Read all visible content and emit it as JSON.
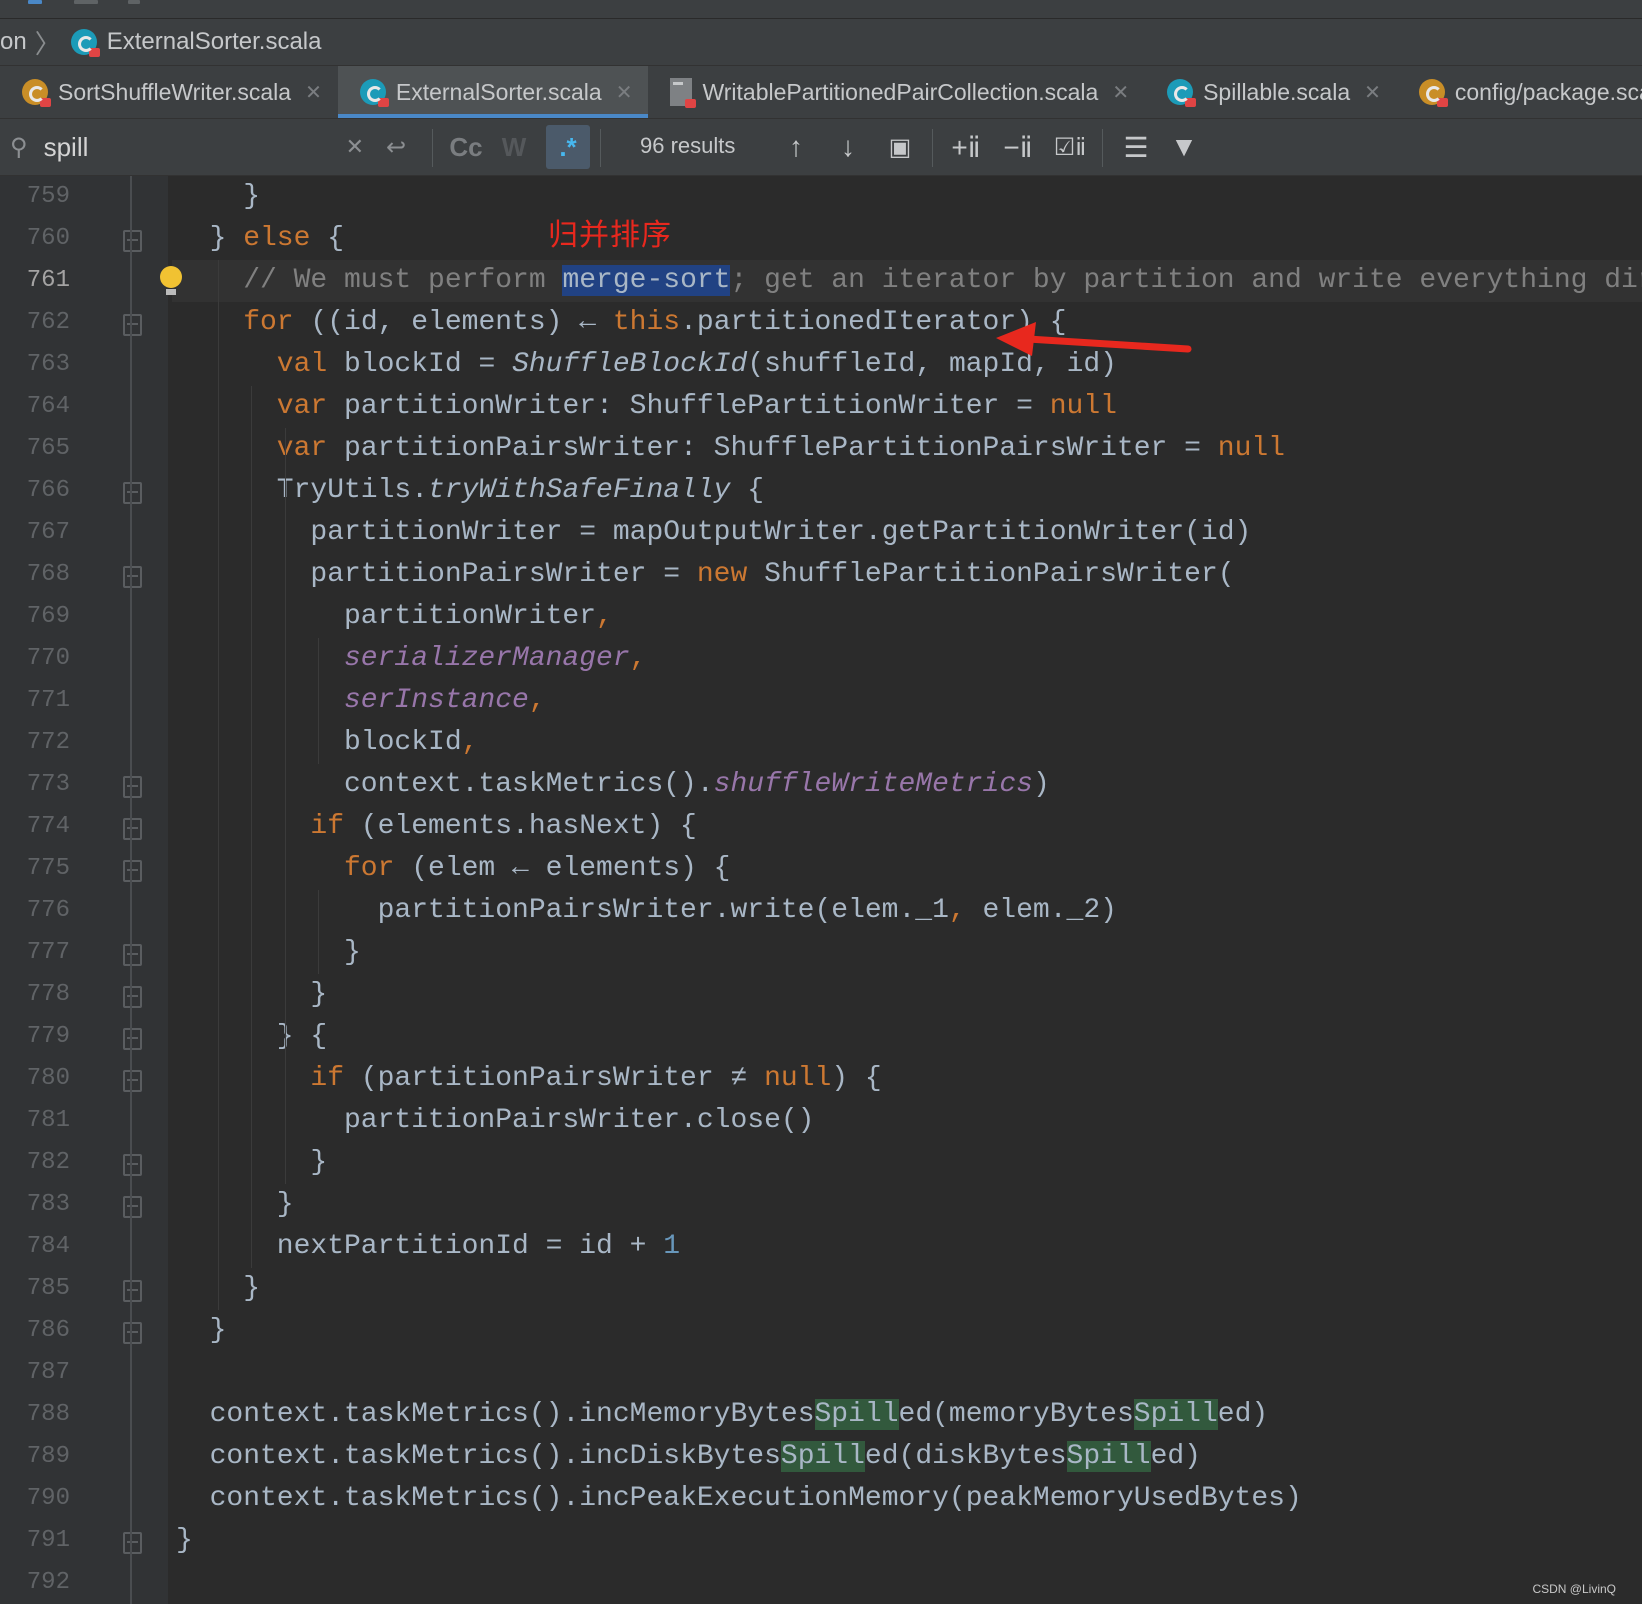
{
  "breadcrumb": {
    "prefix": "on",
    "file": "ExternalSorter.scala"
  },
  "tabs": [
    {
      "label": "SortShuffleWriter.scala",
      "icon": "scala-class-icon",
      "closable": true,
      "active": false
    },
    {
      "label": "ExternalSorter.scala",
      "icon": "scala-class-icon",
      "closable": true,
      "active": true
    },
    {
      "label": "WritablePartitionedPairCollection.scala",
      "icon": "scala-file-icon",
      "closable": true,
      "active": false
    },
    {
      "label": "Spillable.scala",
      "icon": "scala-class-icon",
      "closable": true,
      "active": false
    },
    {
      "label": "config/package.scal",
      "icon": "scala-object-icon",
      "closable": false,
      "active": false
    }
  ],
  "search": {
    "value": "spill",
    "match_case_label": "Cc",
    "words_label": "W",
    "regex_label": ".*",
    "results": "96 results"
  },
  "line_numbers": [
    "759",
    "760",
    "761",
    "762",
    "763",
    "764",
    "765",
    "766",
    "767",
    "768",
    "769",
    "770",
    "771",
    "772",
    "773",
    "774",
    "775",
    "776",
    "777",
    "778",
    "779",
    "780",
    "781",
    "782",
    "783",
    "784",
    "785",
    "786",
    "787",
    "788",
    "789",
    "790",
    "791",
    "792"
  ],
  "current_line": "761",
  "code": {
    "l759": "}",
    "l760a": "} ",
    "l760b": "else",
    "l760c": " {",
    "l761a": "// We must perform ",
    "l761b": "merge-sort",
    "l761c": "; get an iterator by partition and write everything directl",
    "l762a": "for",
    "l762b": " ((id, elements) ← ",
    "l762c": "this",
    "l762d": ".partitionedIterator) {",
    "l763a": "val",
    "l763b": " blockId = ",
    "l763c": "ShuffleBlockId",
    "l763d": "(shuffleId, mapId, id)",
    "l764a": "var",
    "l764b": " partitionWriter: ShufflePartitionWriter = ",
    "l764c": "null",
    "l765a": "var",
    "l765b": " partitionPairsWriter: ShufflePartitionPairsWriter = ",
    "l765c": "null",
    "l766a": "TryUtils.",
    "l766b": "tryWithSafeFinally",
    "l766c": " {",
    "l767": "partitionWriter = mapOutputWriter.getPartitionWriter(id)",
    "l768a": "partitionPairsWriter = ",
    "l768b": "new",
    "l768c": " ShufflePartitionPairsWriter(",
    "l769a": "partitionWriter",
    "l769b": ",",
    "l770a": "serializerManager",
    "l770b": ",",
    "l771a": "serInstance",
    "l771b": ",",
    "l772a": "blockId",
    "l772b": ",",
    "l773a": "context.taskMetrics().",
    "l773b": "shuffleWriteMetrics",
    "l773c": ")",
    "l774a": "if",
    "l774b": " (elements.hasNext) {",
    "l775a": "for",
    "l775b": " (elem ← elements) {",
    "l776a": "partitionPairsWriter.write(elem._1",
    "l776b": ",",
    "l776c": " elem._2)",
    "l777": "}",
    "l778": "}",
    "l779": "} {",
    "l780a": "if",
    "l780b": " (partitionPairsWriter ≠ ",
    "l780c": "null",
    "l780d": ") {",
    "l781": "partitionPairsWriter.close()",
    "l782": "}",
    "l783": "}",
    "l784a": "nextPartitionId = id + ",
    "l784b": "1",
    "l785": "}",
    "l786": "}",
    "l788a": "context.taskMetrics().incMemoryBytes",
    "l788b": "Spill",
    "l788c": "ed(memoryBytes",
    "l788d": "Spill",
    "l788e": "ed)",
    "l789a": "context.taskMetrics().incDiskBytes",
    "l789b": "Spill",
    "l789c": "ed(diskBytes",
    "l789d": "Spill",
    "l789e": "ed)",
    "l790": "context.taskMetrics().incPeakExecutionMemory(peakMemoryUsedBytes)",
    "l791": "}"
  },
  "annotation": "归并排序",
  "watermark": "CSDN @LivinQ",
  "colors": {
    "keyword": "#cc7832",
    "comment": "#808080",
    "purple": "#9876aa",
    "number": "#6897bb",
    "search_highlight": "#214283",
    "match_highlight": "#32593d",
    "annotation": "#e8281e"
  }
}
